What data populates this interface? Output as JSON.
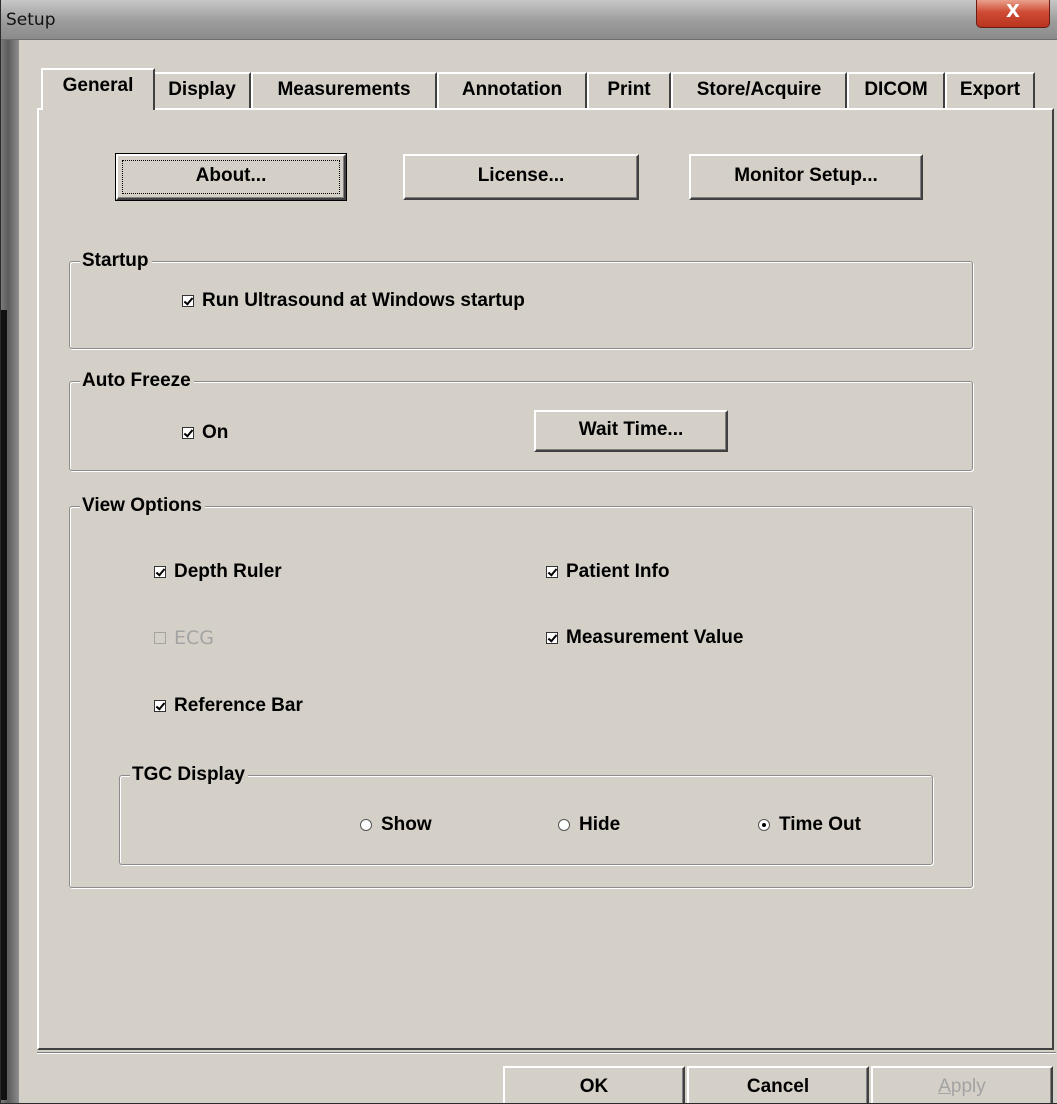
{
  "window": {
    "title": "Setup",
    "close_label": "X"
  },
  "tabs": [
    {
      "label": "General",
      "active": true
    },
    {
      "label": "Display",
      "active": false
    },
    {
      "label": "Measurements",
      "active": false
    },
    {
      "label": "Annotation",
      "active": false
    },
    {
      "label": "Print",
      "active": false
    },
    {
      "label": "Store/Acquire",
      "active": false
    },
    {
      "label": "DICOM",
      "active": false
    },
    {
      "label": "Export",
      "active": false
    }
  ],
  "general": {
    "buttons": {
      "about": "About...",
      "license": "License...",
      "monitor_setup": "Monitor Setup..."
    },
    "startup": {
      "title": "Startup",
      "run_at_startup": {
        "label": "Run Ultrasound at Windows startup",
        "checked": true
      }
    },
    "auto_freeze": {
      "title": "Auto Freeze",
      "on": {
        "label": "On",
        "checked": true
      },
      "wait_time": "Wait Time..."
    },
    "view_options": {
      "title": "View Options",
      "depth_ruler": {
        "label": "Depth Ruler",
        "checked": true
      },
      "ecg": {
        "label": "ECG",
        "checked": false,
        "disabled": true
      },
      "reference_bar": {
        "label": "Reference Bar",
        "checked": true
      },
      "patient_info": {
        "label": "Patient Info",
        "checked": true
      },
      "measurement_value": {
        "label": "Measurement Value",
        "checked": true
      },
      "tgc_display": {
        "title": "TGC Display",
        "options": [
          {
            "label": "Show",
            "selected": false
          },
          {
            "label": "Hide",
            "selected": false
          },
          {
            "label": "Time Out",
            "selected": true
          }
        ]
      }
    }
  },
  "footer": {
    "ok": "OK",
    "cancel": "Cancel",
    "apply_prefix": "A",
    "apply_rest": "pply"
  },
  "colors": {
    "dialog_bg": "#d4d0c8",
    "close_button": "#c7432d",
    "disabled_text": "#a3a3a3"
  }
}
